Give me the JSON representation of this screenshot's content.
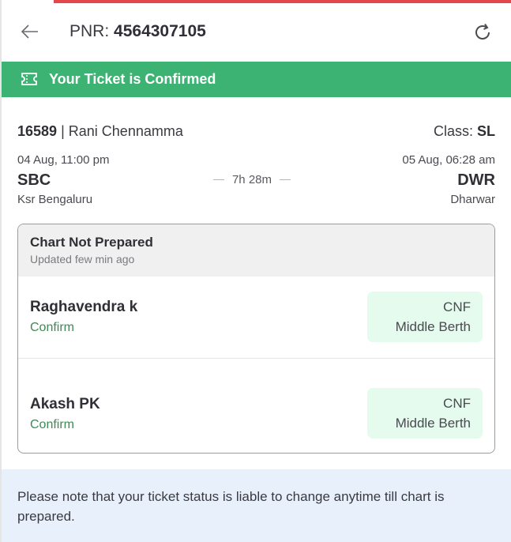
{
  "header": {
    "pnr_label": "PNR:",
    "pnr_number": "4564307105"
  },
  "banner": {
    "text": "Your Ticket is Confirmed"
  },
  "train": {
    "number": "16589",
    "separator": "|",
    "name": "Rani Chennamma",
    "class_label": "Class:",
    "class_value": "SL"
  },
  "journey": {
    "departure": {
      "time": "04 Aug, 11:00 pm",
      "code": "SBC",
      "station": "Ksr Bengaluru"
    },
    "arrival": {
      "time": "05 Aug, 06:28 am",
      "code": "DWR",
      "station": "Dharwar"
    },
    "duration": "7h 28m"
  },
  "chart": {
    "title": "Chart Not Prepared",
    "updated": "Updated few min ago"
  },
  "passengers": [
    {
      "name": "Raghavendra k",
      "status": "Confirm",
      "booking": "CNF",
      "berth": "Middle Berth"
    },
    {
      "name": "Akash PK",
      "status": "Confirm",
      "booking": "CNF",
      "berth": "Middle Berth"
    }
  ],
  "note": "Please note that your ticket status is liable to change anytime till chart is prepared.",
  "colors": {
    "accent_red": "#e3474b",
    "confirm_green": "#3db373",
    "status_green": "#3d8a52",
    "berth_bg": "#e4fbee",
    "note_bg": "#e8f0fc"
  },
  "icons": {
    "back": "arrow-left-icon",
    "refresh": "refresh-icon",
    "ticket": "ticket-icon"
  }
}
